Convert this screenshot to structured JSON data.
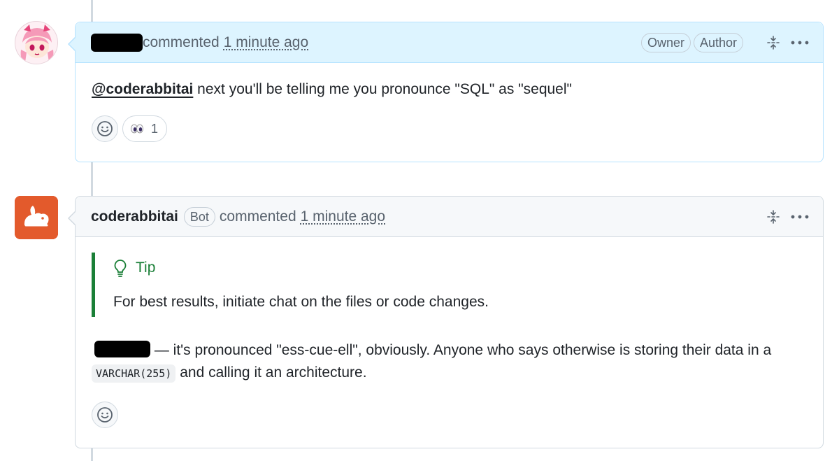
{
  "comments": [
    {
      "action": "commented",
      "timestamp": "1 minute ago",
      "labels": [
        "Owner",
        "Author"
      ],
      "body": {
        "mention": "@coderabbitai",
        "text": " next you'll be telling me you pronounce \"SQL\" as \"sequel\""
      },
      "reactions": [
        {
          "emoji": "eyes",
          "count": "1"
        }
      ],
      "icons": {
        "collapse": "fold-icon",
        "more": "kebab-icon",
        "add_reaction": "smiley-icon",
        "avatar": "anime-avatar"
      }
    },
    {
      "author": "coderabbitai",
      "badge": "Bot",
      "action": "commented",
      "timestamp": "1 minute ago",
      "tip": {
        "title": "Tip",
        "text": "For best results, initiate chat on the files or code changes."
      },
      "body": {
        "line1": " — it's pronounced \"ess-cue-ell\", obviously. Anyone who says otherwise is storing their data in a",
        "code": "VARCHAR(255)",
        "line2": " and calling it an architecture."
      },
      "icons": {
        "collapse": "fold-icon",
        "more": "kebab-icon",
        "add_reaction": "smiley-icon",
        "tip": "light-bulb-icon",
        "avatar": "rabbit-logo"
      }
    }
  ],
  "colors": {
    "owner_header_bg": "#ddf4ff",
    "owner_border": "#b6e3ff",
    "tip_accent": "#1a7f37",
    "bot_avatar_bg": "#e35a2c"
  }
}
